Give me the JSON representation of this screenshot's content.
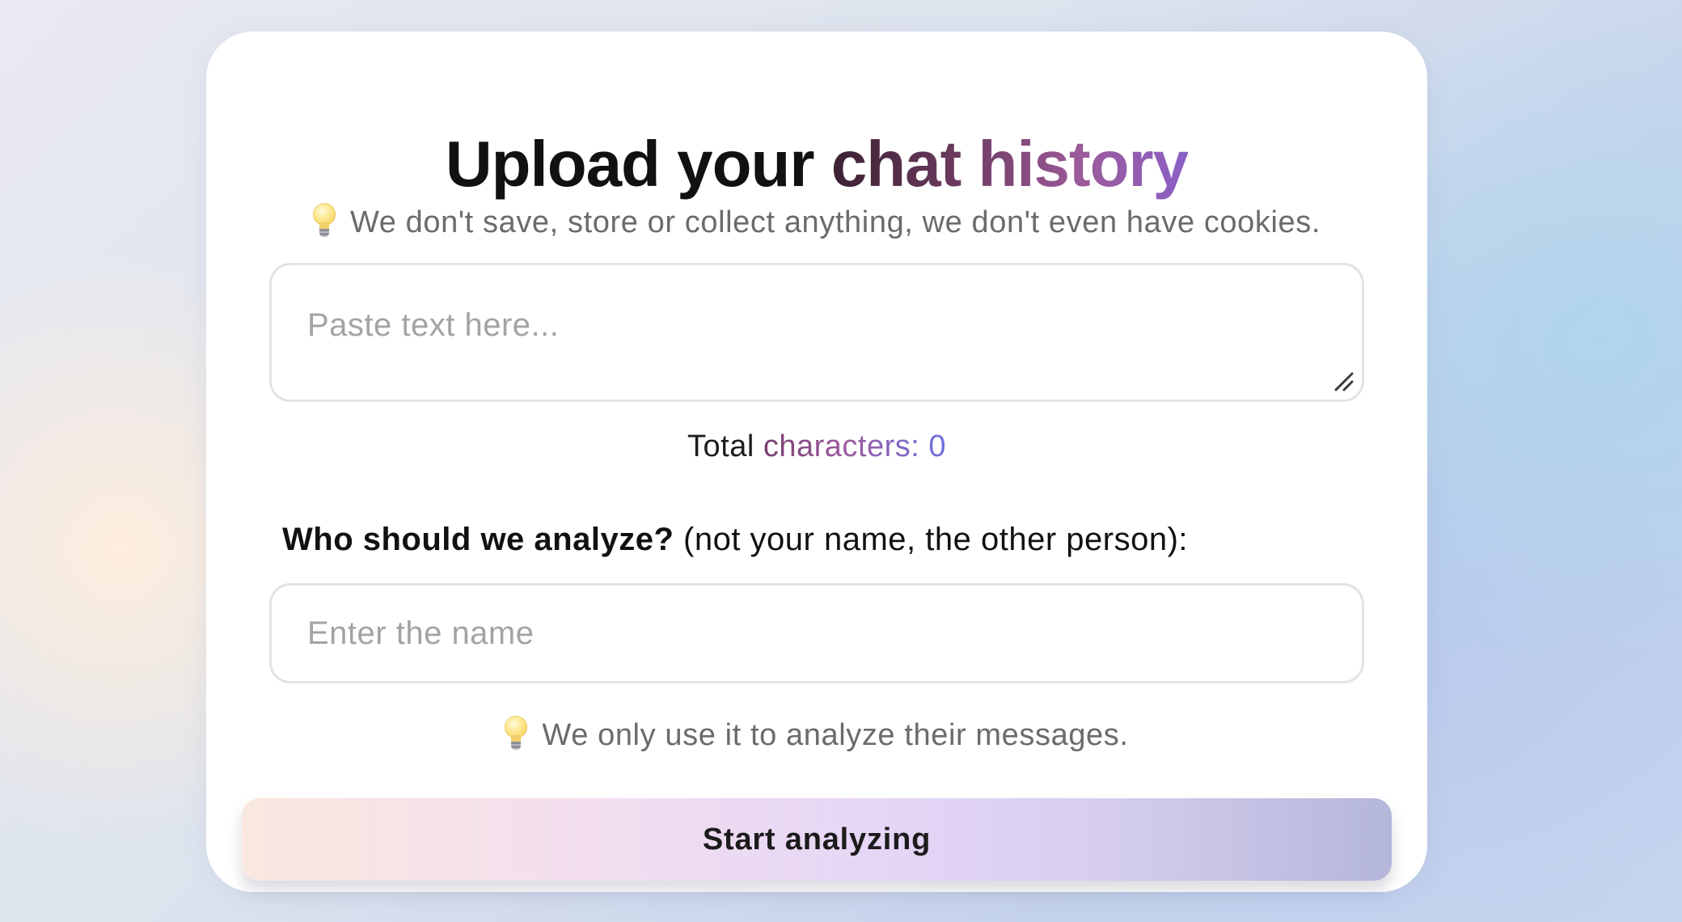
{
  "title": {
    "part1": "Upload your ",
    "part2": "chat history"
  },
  "privacy_note": "We don't save, store or collect anything, we don't even have cookies.",
  "chat_input": {
    "placeholder": "Paste text here...",
    "value": ""
  },
  "char_count": {
    "label_plain": "Total ",
    "label_accent": "characters: ",
    "value": "0"
  },
  "question": {
    "bold": "Who should we analyze?",
    "rest": " (not your name, the other person):"
  },
  "name_input": {
    "placeholder": "Enter the name",
    "value": ""
  },
  "name_note": "We only use it to analyze their messages.",
  "start_button": {
    "label": "Start analyzing"
  },
  "icons": {
    "privacy": "lightbulb-icon",
    "name_note": "lightbulb-icon",
    "resize": "resize-handle-icon"
  },
  "colors": {
    "title_gradient_start": "#3a2132",
    "title_gradient_end": "#8a5fc6",
    "button_gradient_start": "#f9e8df",
    "button_gradient_end": "#b4b7da"
  }
}
